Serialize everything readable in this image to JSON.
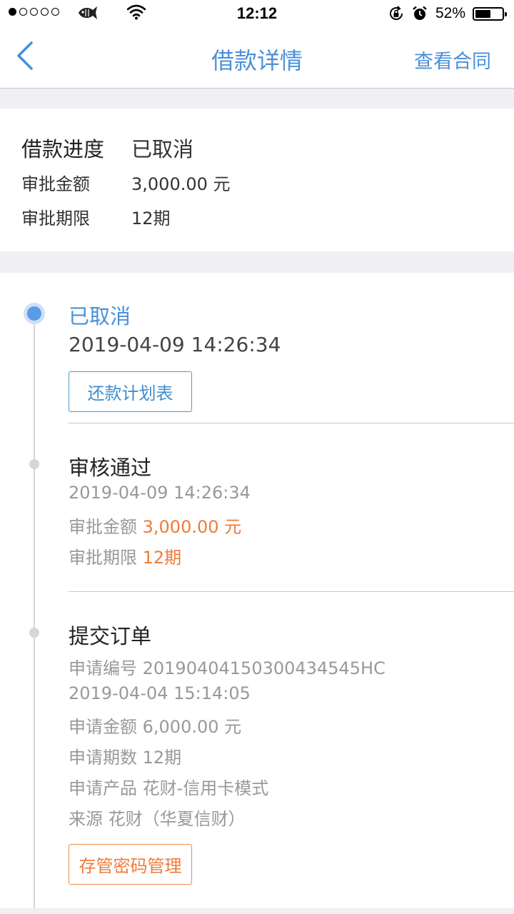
{
  "status_bar": {
    "time": "12:12",
    "battery": "52%"
  },
  "nav": {
    "title": "借款详情",
    "right_action": "查看合同"
  },
  "summary": {
    "progress_label": "借款进度",
    "progress_value": "已取消",
    "amount_label": "审批金额",
    "amount_value": "3,000.00 元",
    "term_label": "审批期限",
    "term_value": "12期"
  },
  "timeline": {
    "cancelled": {
      "title": "已取消",
      "time": "2019-04-09 14:26:34",
      "button": "还款计划表"
    },
    "approved": {
      "title": "审核通过",
      "time": "2019-04-09 14:26:34",
      "amount_label": "审批金额",
      "amount_value": "3,000.00 元",
      "term_label": "审批期限",
      "term_value": "12期"
    },
    "submitted": {
      "title": "提交订单",
      "lines": [
        "申请编号 20190404150300434545HC",
        "2019-04-04 15:14:05",
        "申请金额 6,000.00 元",
        "申请期数 12期",
        "申请产品 花财-信用卡模式",
        "来源 花财（华夏信财）"
      ],
      "button": "存管密码管理"
    }
  },
  "colors": {
    "accent_blue": "#4a90d9",
    "highlight_orange": "#f07a3a",
    "muted_grey": "#999999",
    "background_grey": "#efeff4"
  }
}
